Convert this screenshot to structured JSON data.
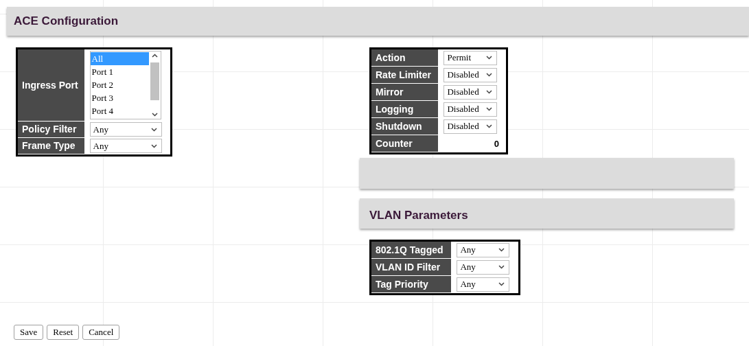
{
  "title": "ACE Configuration",
  "ingress_port": {
    "label": "Ingress Port",
    "options": [
      {
        "label": "All",
        "selected": true
      },
      {
        "label": "Port 1",
        "selected": false
      },
      {
        "label": "Port 2",
        "selected": false
      },
      {
        "label": "Port 3",
        "selected": false
      },
      {
        "label": "Port 4",
        "selected": false
      }
    ]
  },
  "left_fields": [
    {
      "label": "Policy Filter",
      "value": "Any"
    },
    {
      "label": "Frame Type",
      "value": "Any"
    }
  ],
  "action_fields": [
    {
      "kind": "select",
      "label": "Action",
      "value": "Permit"
    },
    {
      "kind": "select",
      "label": "Rate Limiter",
      "value": "Disabled"
    },
    {
      "kind": "select",
      "label": "Mirror",
      "value": "Disabled"
    },
    {
      "kind": "select",
      "label": "Logging",
      "value": "Disabled"
    },
    {
      "kind": "select",
      "label": "Shutdown",
      "value": "Disabled"
    },
    {
      "kind": "counter",
      "label": "Counter",
      "value": "0"
    }
  ],
  "vlan_parameters": {
    "title": "VLAN Parameters",
    "fields": [
      {
        "label": "802.1Q Tagged",
        "value": "Any"
      },
      {
        "label": "VLAN ID Filter",
        "value": "Any"
      },
      {
        "label": "Tag Priority",
        "value": "Any"
      }
    ]
  },
  "buttons": [
    "Save",
    "Reset",
    "Cancel"
  ]
}
